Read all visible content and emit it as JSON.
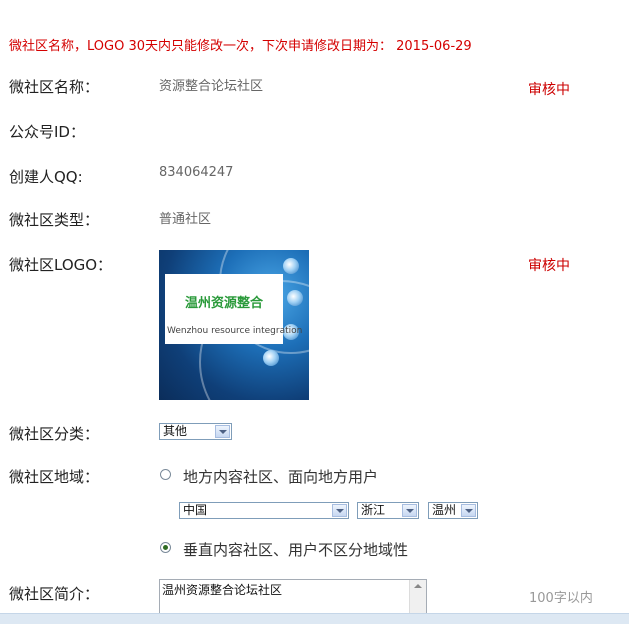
{
  "notice": "微社区名称，LOGO 30天内只能修改一次，下次申请修改日期为： 2015-06-29",
  "fields": {
    "name": {
      "label": "微社区名称：",
      "value": "资源整合论坛社区",
      "status": "审核中"
    },
    "public_id": {
      "label": "公众号ID："
    },
    "creator_qq": {
      "label": "创建人QQ:",
      "value": "834064247"
    },
    "type": {
      "label": "微社区类型：",
      "value": "普通社区"
    },
    "logo": {
      "label": "微社区LOGO：",
      "status": "审核中",
      "logo_text_cn": "温州资源整合",
      "logo_text_en": "Wenzhou resource integration"
    },
    "category": {
      "label": "微社区分类：",
      "selected": "其他"
    },
    "region": {
      "label": "微社区地域：",
      "option_local": "地方内容社区、面向地方用户",
      "country": "中国",
      "province": "浙江",
      "city": "温州",
      "option_vertical": "垂直内容社区、用户不区分地域性"
    },
    "intro": {
      "label": "微社区简介：",
      "value": "温州资源整合论坛社区",
      "hint": "100字以内"
    }
  },
  "colors": {
    "notice": "#d40000",
    "status": "#cc0000",
    "label": "#222222",
    "value": "#666666"
  }
}
